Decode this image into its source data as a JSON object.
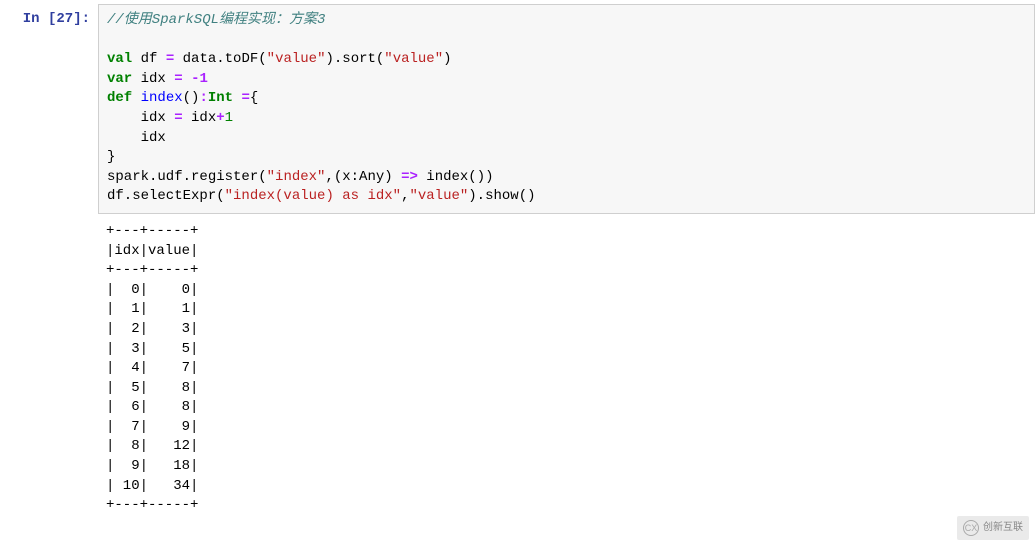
{
  "prompt": "In [27]:",
  "code": {
    "comment": "//使用SparkSQL编程实现：方案3",
    "l1": {
      "kw_val": "val",
      "name": "df",
      "eq": "=",
      "rhs1": " data.toDF(",
      "str1": "\"value\"",
      "mid": ").sort(",
      "str2": "\"value\"",
      "end": ")"
    },
    "l2": {
      "kw_var": "var",
      "name": "idx",
      "eq": "=",
      "num": "-1"
    },
    "l3": {
      "kw_def": "def",
      "name": "index",
      "parens": "()",
      "colon": ":",
      "type": "Int",
      "eq2": "=",
      "brace": "{"
    },
    "l4": {
      "indent": "    ",
      "lhs": "idx ",
      "eq": "=",
      "rhs": " idx",
      "plus": "+",
      "one": "1"
    },
    "l5": {
      "indent": "    ",
      "txt": "idx"
    },
    "l6": {
      "txt": "}"
    },
    "l7": {
      "pre": "spark.udf.register(",
      "s1": "\"index\"",
      "mid": ",(x:Any) ",
      "arrow": "=>",
      "post": " index())"
    },
    "l8": {
      "pre": "df.selectExpr(",
      "s1": "\"index(value) as idx\"",
      "comma": ",",
      "s2": "\"value\"",
      "post": ").show()"
    }
  },
  "chart_data": {
    "type": "table",
    "columns": [
      "idx",
      "value"
    ],
    "rows": [
      [
        0,
        0
      ],
      [
        1,
        1
      ],
      [
        2,
        3
      ],
      [
        3,
        5
      ],
      [
        4,
        7
      ],
      [
        5,
        8
      ],
      [
        6,
        8
      ],
      [
        7,
        9
      ],
      [
        8,
        12
      ],
      [
        9,
        18
      ],
      [
        10,
        34
      ]
    ]
  },
  "watermark": {
    "icon": "CX",
    "text": "创新互联"
  }
}
